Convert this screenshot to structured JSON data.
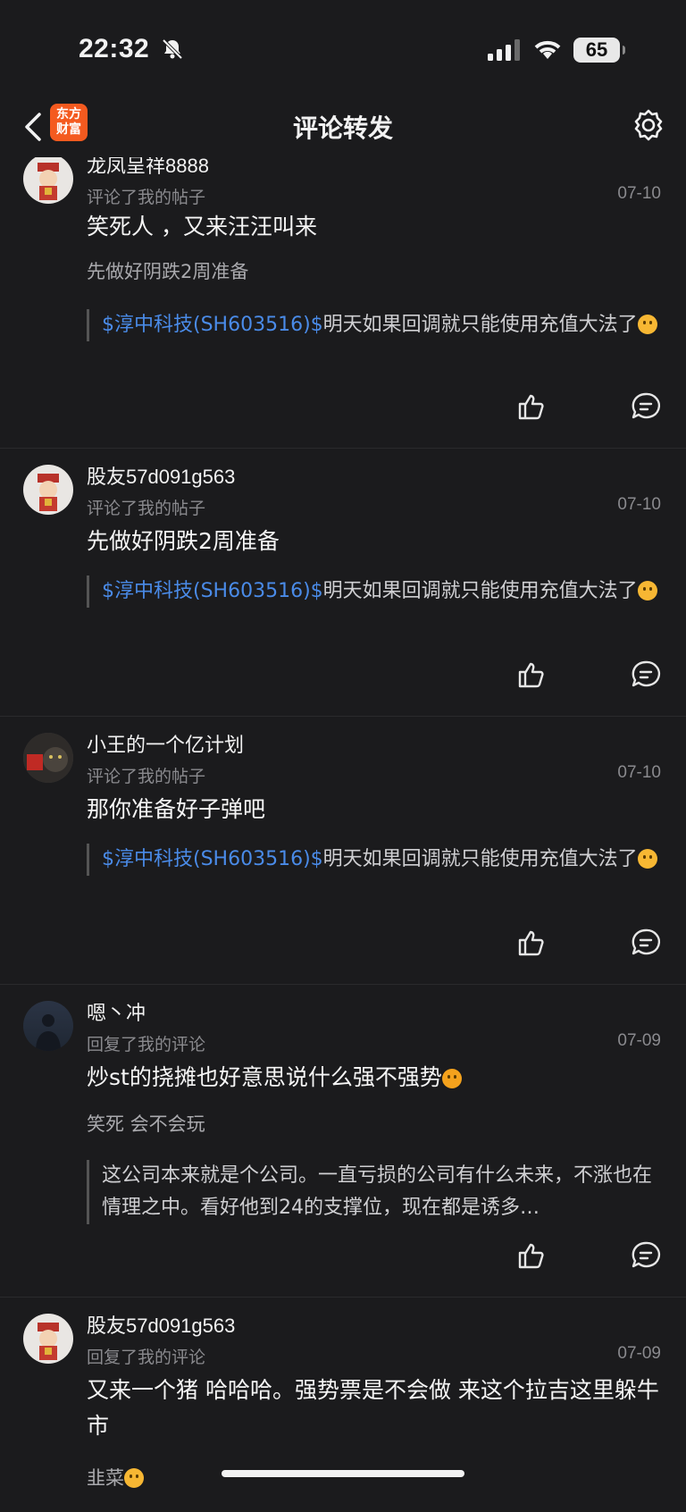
{
  "status_bar": {
    "time": "22:32",
    "battery": "65"
  },
  "nav": {
    "logo_line1": "东方",
    "logo_line2": "财富",
    "title": "评论转发"
  },
  "items": [
    {
      "user": "龙凤呈祥8888",
      "action": "评论了我的帖子",
      "date": "07-10",
      "comment": "笑死人 ，又来汪汪叫来",
      "sub": "先做好阴跌2周准备",
      "quote_stock": "$淳中科技(SH603516)$",
      "quote_text": "明天如果回调就只能使用充值大法了"
    },
    {
      "user": "股友57d091g563",
      "action": "评论了我的帖子",
      "date": "07-10",
      "comment": "先做好阴跌2周准备",
      "quote_stock": "$淳中科技(SH603516)$",
      "quote_text": "明天如果回调就只能使用充值大法了"
    },
    {
      "user": "小王的一个亿计划",
      "action": "评论了我的帖子",
      "date": "07-10",
      "comment": "那你准备好子弹吧",
      "quote_stock": "$淳中科技(SH603516)$",
      "quote_text": "明天如果回调就只能使用充值大法了"
    },
    {
      "user": "嗯丶冲",
      "action": "回复了我的评论",
      "date": "07-09",
      "comment": "炒st的挠摊也好意思说什么强不强势",
      "sub": "笑死  会不会玩",
      "quote_text": "这公司本来就是个公司。一直亏损的公司有什么未来，不涨也在情理之中。看好他到24的支撑位，现在都是诱多…"
    },
    {
      "user": "股友57d091g563",
      "action": "回复了我的评论",
      "date": "07-09",
      "comment": "又来一个猪 哈哈哈。强势票是不会做 来这个拉吉这里躲牛市",
      "sub": "韭菜"
    }
  ]
}
